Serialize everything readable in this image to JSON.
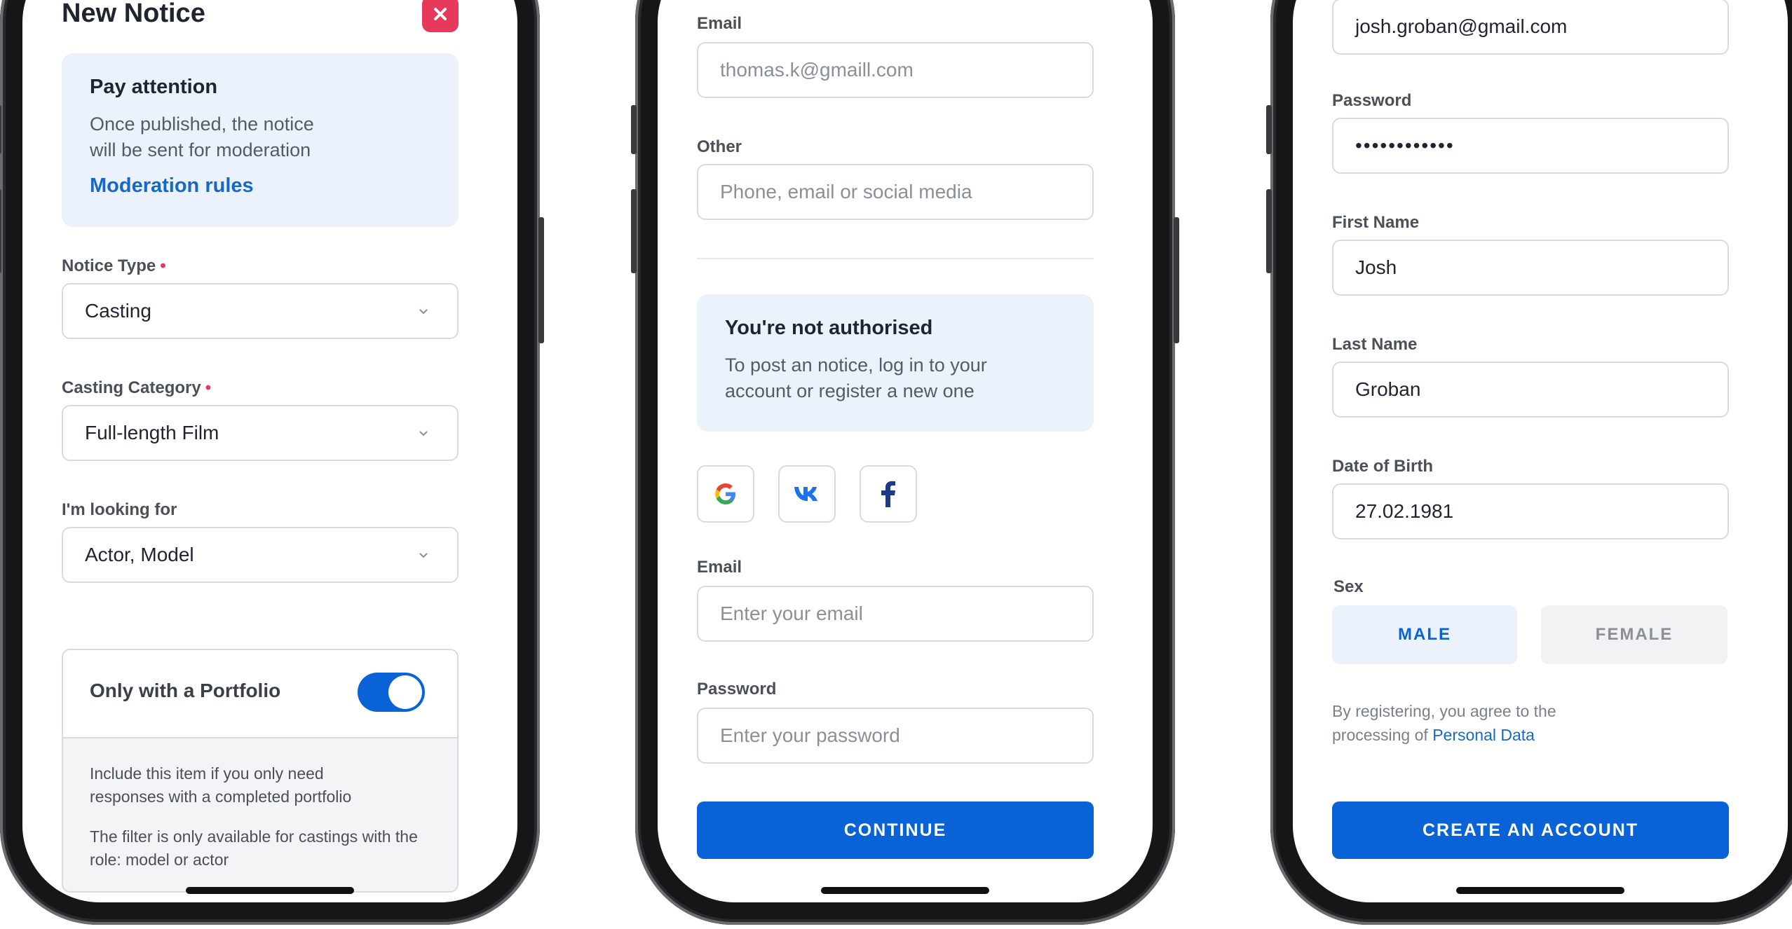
{
  "phone1": {
    "title": "New Notice",
    "info": {
      "title": "Pay attention",
      "text": "Once published, the notice will be sent for moderation",
      "link": "Moderation rules"
    },
    "notice_type": {
      "label": "Notice Type",
      "required_mark": "•",
      "value": "Casting"
    },
    "casting_category": {
      "label": "Casting Category",
      "required_mark": "•",
      "value": "Full-length Film"
    },
    "looking_for": {
      "label": "I'm looking for",
      "value": "Actor, Model"
    },
    "portfolio": {
      "label": "Only with a Portfolio",
      "enabled": true,
      "hint1": "Include this item if you only need responses with a completed portfolio",
      "hint2": "The filter is only available for castings with the role: model or actor"
    }
  },
  "phone2": {
    "email_top": {
      "label": "Email",
      "placeholder": "thomas.k@gmaill.com"
    },
    "other": {
      "label": "Other",
      "placeholder": "Phone, email or social media"
    },
    "info": {
      "title": "You're not authorised",
      "text": "To post an notice, log in to your account or register a new one"
    },
    "social": [
      "google-icon",
      "vk-icon",
      "facebook-icon"
    ],
    "email": {
      "label": "Email",
      "placeholder": "Enter your email"
    },
    "password": {
      "label": "Password",
      "placeholder": "Enter your password"
    },
    "continue": "CONTINUE"
  },
  "phone3": {
    "email_value": "josh.groban@gmail.com",
    "password": {
      "label": "Password",
      "value": "••••••••••••"
    },
    "first_name": {
      "label": "First Name",
      "value": "Josh"
    },
    "last_name": {
      "label": "Last Name",
      "value": "Groban"
    },
    "dob": {
      "label": "Date of Birth",
      "value": "27.02.1981"
    },
    "sex": {
      "label": "Sex",
      "male": "MALE",
      "female": "FEMALE",
      "selected": "MALE"
    },
    "consent_text": "By registering, you agree to the processing of",
    "consent_link": "Personal Data",
    "create": "CREATE AN ACCOUNT"
  },
  "colors": {
    "accent": "#0a63d6",
    "link": "#1569c7",
    "info_bg": "#ebf2fc",
    "close": "#e6395b"
  }
}
